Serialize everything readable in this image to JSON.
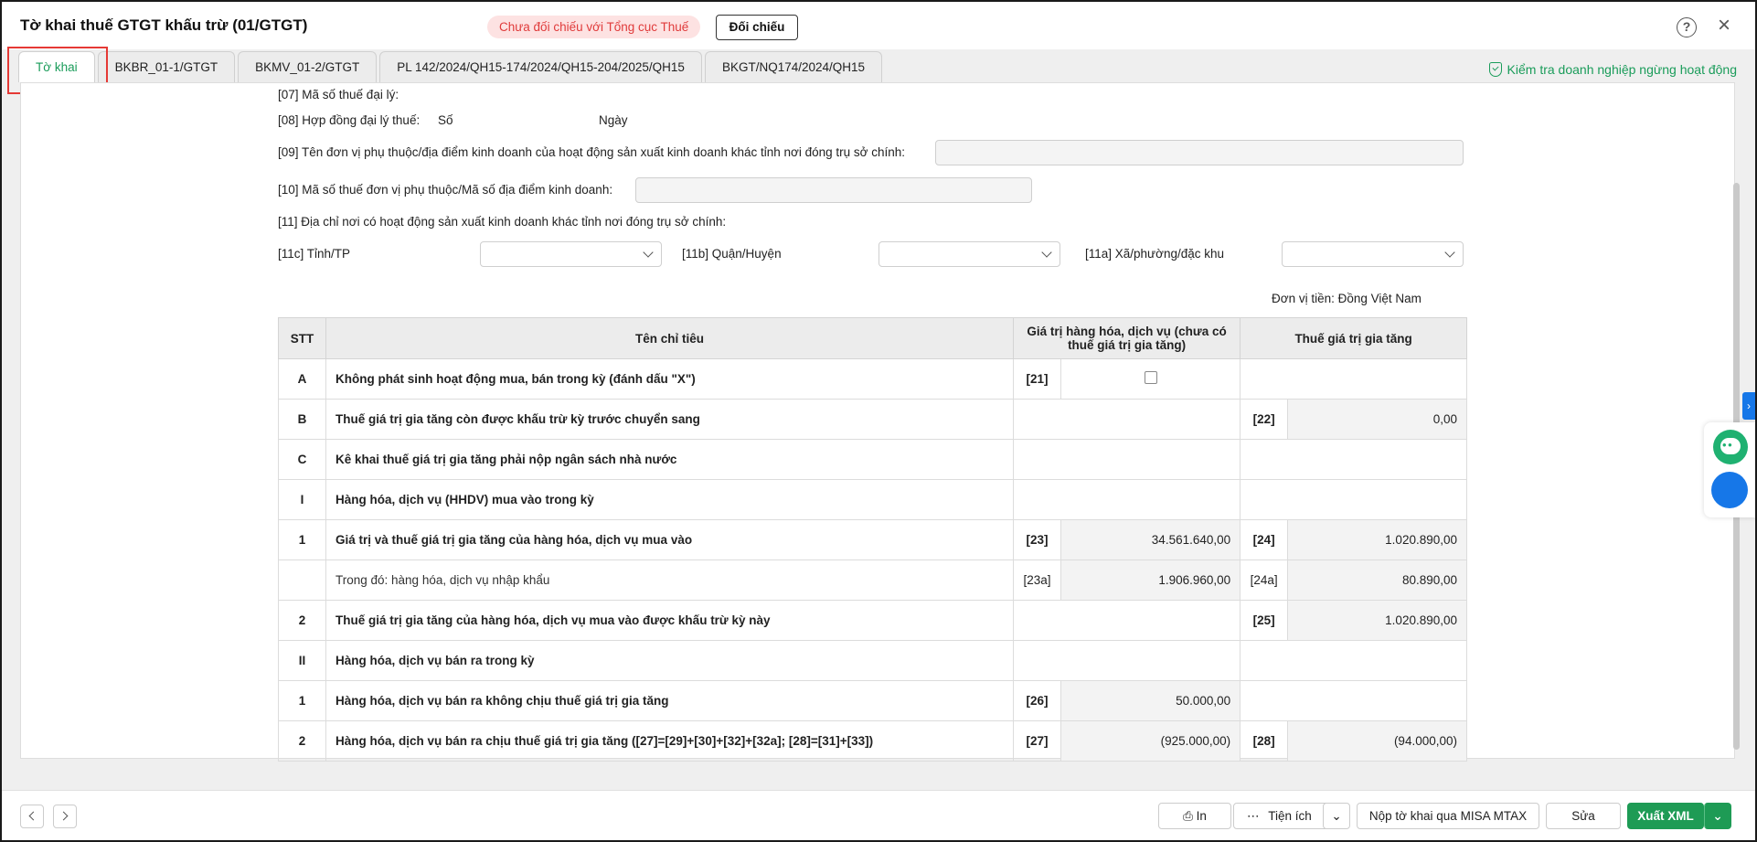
{
  "window": {
    "title": "Tờ khai thuế GTGT khấu trừ (01/GTGT)",
    "warning_badge": "Chưa đối chiếu với Tổng cục Thuế",
    "compare_button": "Đối chiếu"
  },
  "tabs": [
    {
      "label": "Tờ khai",
      "active": true
    },
    {
      "label": "BKBR_01-1/GTGT",
      "active": false
    },
    {
      "label": "BKMV_01-2/GTGT",
      "active": false
    },
    {
      "label": "PL 142/2024/QH15-174/2024/QH15-204/2025/QH15",
      "active": false
    },
    {
      "label": "BKGT/NQ174/2024/QH15",
      "active": false
    }
  ],
  "check_link": "Kiểm tra doanh nghiệp ngừng hoạt động",
  "form": {
    "f07_label": "[07] Mã số thuế đại lý:",
    "f08_label": "[08] Hợp đồng đại lý thuế:",
    "f08_so": "Số",
    "f08_ngay": "Ngày",
    "f09_label": "[09] Tên đơn vị phụ thuộc/địa điểm kinh doanh của hoạt động sản xuất kinh doanh khác tỉnh nơi đóng trụ sở chính:",
    "f09_value": "",
    "f10_label": "[10] Mã số thuế đơn vị phụ thuộc/Mã số địa điểm kinh doanh:",
    "f10_value": "",
    "f11_label": "[11] Địa chỉ nơi có hoạt động sản xuất kinh doanh khác tỉnh nơi đóng trụ sở chính:",
    "f11c_label": "[11c] Tỉnh/TP",
    "f11c_value": "",
    "f11b_label": "[11b] Quận/Huyện",
    "f11b_value": "",
    "f11a_label": "[11a] Xã/phường/đặc khu",
    "f11a_value": "",
    "currency_unit": "Đơn vị tiền: Đồng Việt Nam"
  },
  "table": {
    "headers": {
      "stt": "STT",
      "name": "Tên chỉ tiêu",
      "value": "Giá trị hàng hóa, dịch vụ (chưa có thuế giá trị gia tăng)",
      "vat": "Thuế giá trị gia tăng"
    },
    "rows": [
      {
        "stt": "A",
        "name": "Không phát sinh hoạt động mua, bán trong kỳ (đánh dấu \"X\")",
        "code1": "[21]",
        "val1": "",
        "checkbox": true,
        "code2": "",
        "val2": ""
      },
      {
        "stt": "B",
        "name": "Thuế giá trị gia tăng còn được khấu trừ kỳ trước chuyển sang",
        "code1": "",
        "val1": "",
        "code2": "[22]",
        "val2": "0,00"
      },
      {
        "stt": "C",
        "name": "Kê khai thuế giá trị gia tăng phải nộp ngân sách nhà nước",
        "code1": "",
        "val1": "",
        "code2": "",
        "val2": ""
      },
      {
        "stt": "I",
        "name": "Hàng hóa, dịch vụ (HHDV) mua vào trong kỳ",
        "code1": "",
        "val1": "",
        "code2": "",
        "val2": ""
      },
      {
        "stt": "1",
        "name": "Giá trị và thuế giá trị gia tăng của hàng hóa, dịch vụ mua vào",
        "code1": "[23]",
        "val1": "34.561.640,00",
        "code2": "[24]",
        "val2": "1.020.890,00"
      },
      {
        "stt": "",
        "name": "Trong đó: hàng hóa, dịch vụ nhập khẩu",
        "plain": true,
        "code1": "[23a]",
        "val1": "1.906.960,00",
        "code2": "[24a]",
        "val2": "80.890,00"
      },
      {
        "stt": "2",
        "name": "Thuế giá trị gia tăng của hàng hóa, dịch vụ mua vào được khấu trừ kỳ này",
        "code1": "",
        "val1": "",
        "code2": "[25]",
        "val2": "1.020.890,00"
      },
      {
        "stt": "II",
        "name": "Hàng hóa, dịch vụ bán ra trong kỳ",
        "code1": "",
        "val1": "",
        "code2": "",
        "val2": ""
      },
      {
        "stt": "1",
        "name": "Hàng hóa, dịch vụ bán ra không chịu thuế giá trị gia tăng",
        "code1": "[26]",
        "val1": "50.000,00",
        "code2": "",
        "val2": ""
      },
      {
        "stt": "2",
        "name": "Hàng hóa, dịch vụ bán ra chịu thuế giá trị gia tăng ([27]=[29]+[30]+[32]+[32a]; [28]=[31]+[33])",
        "code1": "[27]",
        "val1": "(925.000,00)",
        "neg1": true,
        "code2": "[28]",
        "val2": "(94.000,00)",
        "neg2": true
      }
    ]
  },
  "footer": {
    "print_label": "In",
    "utilities_label": "Tiện ích",
    "submit_label": "Nộp tờ khai qua MISA MTAX",
    "edit_label": "Sửa",
    "export_label": "Xuất XML"
  },
  "colors": {
    "accent_green": "#1e9b55",
    "warning_red": "#e03b3b",
    "side_blue": "#1677e8"
  }
}
